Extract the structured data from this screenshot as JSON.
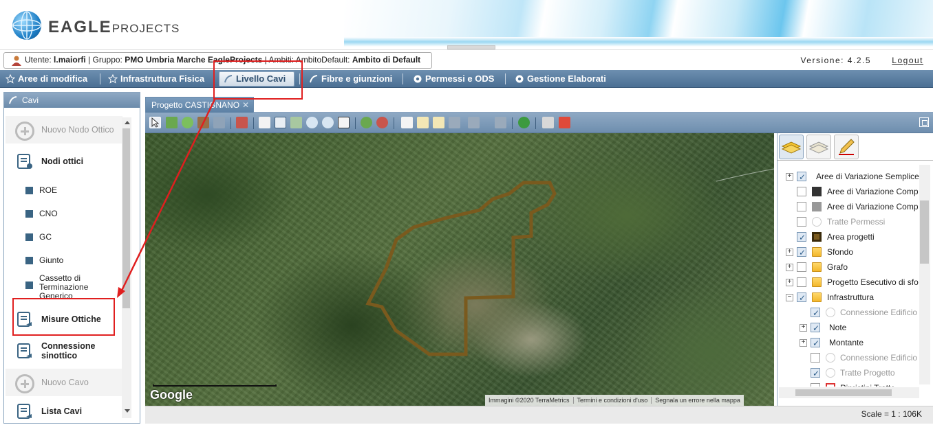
{
  "header": {
    "logo_main": "EAGLE",
    "logo_sub": "PROJECTS"
  },
  "userbar": {
    "utente_label": "Utente:",
    "utente_value": "l.maiorfi",
    "gruppo_label": "| Gruppo:",
    "gruppo_value": "PMO Umbria Marche EagleProjects",
    "ambiti_label": "| Ambiti: AmbitoDefault:",
    "ambiti_value": "Ambito di Default",
    "version": "Versione: 4.2.5",
    "logout": "Logout"
  },
  "menu": {
    "items": [
      {
        "label": "Aree di modifica"
      },
      {
        "label": "Infrastruttura Fisica"
      },
      {
        "label": "Livello Cavi"
      },
      {
        "label": "Fibre e giunzioni"
      },
      {
        "label": "Permessi e ODS"
      },
      {
        "label": "Gestione Elaborati"
      }
    ],
    "active": "Livello Cavi"
  },
  "left_panel": {
    "title": "Cavi",
    "items": [
      {
        "label": "Nuovo Nodo Ottico"
      },
      {
        "label": "Nodi ottici"
      },
      {
        "label": "ROE"
      },
      {
        "label": "CNO"
      },
      {
        "label": "GC"
      },
      {
        "label": "Giunto"
      },
      {
        "label": "Cassetto di Terminazione Generico"
      },
      {
        "label": "Misure Ottiche"
      },
      {
        "label": "Connessione sinottico"
      },
      {
        "label": "Nuovo Cavo"
      },
      {
        "label": "Lista Cavi"
      }
    ]
  },
  "tabs": [
    {
      "label": "Progetto CASTIGNANO",
      "close": "✕"
    }
  ],
  "map": {
    "google": "Google",
    "attribution": [
      "Immagini ©2020 TerraMetrics",
      "Termini e condizioni d'uso",
      "Segnala un errore nella mappa"
    ],
    "scale": "Scale = 1 : 106K"
  },
  "layers": {
    "items": [
      {
        "label": "Aree di Variazione Semplice"
      },
      {
        "label": "Aree di Variazione Comp"
      },
      {
        "label": "Aree di Variazione Comp"
      },
      {
        "label": "Tratte Permessi"
      },
      {
        "label": "Area progetti"
      },
      {
        "label": "Sfondo"
      },
      {
        "label": "Grafo"
      },
      {
        "label": "Progetto Esecutivo di sfo"
      },
      {
        "label": "Infrastruttura"
      },
      {
        "label": "Connessione Edificio"
      },
      {
        "label": "Note"
      },
      {
        "label": "Montante"
      },
      {
        "label": "Connessione Edificio"
      },
      {
        "label": "Tratte Progetto"
      },
      {
        "label": "Ripristini Tratte"
      }
    ]
  },
  "colors": {
    "menubar": "#4b6f93",
    "highlight": "#e01f1f",
    "project_outline": "#7a5a1e"
  }
}
